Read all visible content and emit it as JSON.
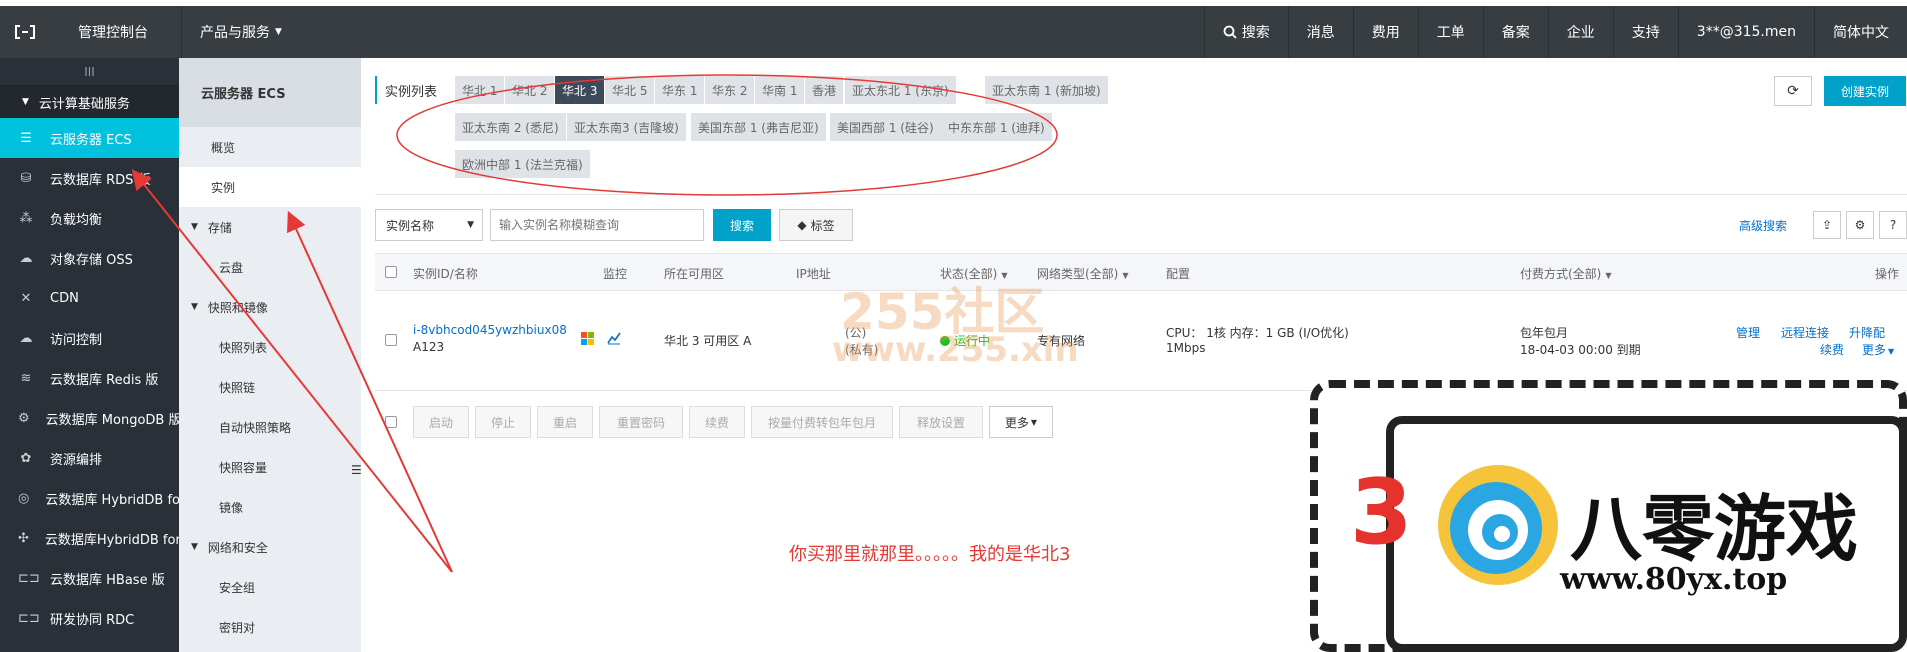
{
  "topbar": {
    "console": "管理控制台",
    "products": "产品与服务",
    "search": "搜索",
    "messages": "消息",
    "billing": "费用",
    "tickets": "工单",
    "icp": "备案",
    "enterprise": "企业",
    "support": "支持",
    "account": "3**@315.men",
    "language": "简体中文"
  },
  "sidebar": {
    "collapse": "III",
    "group": "云计算基础服务",
    "items": [
      {
        "label": "云服务器 ECS",
        "icon": "server-icon"
      },
      {
        "label": "云数据库 RDS 版",
        "icon": "database-icon"
      },
      {
        "label": "负载均衡",
        "icon": "balance-icon"
      },
      {
        "label": "对象存储 OSS",
        "icon": "storage-icon"
      },
      {
        "label": "CDN",
        "icon": "cdn-icon"
      },
      {
        "label": "访问控制",
        "icon": "access-icon"
      },
      {
        "label": "云数据库 Redis 版",
        "icon": "redis-icon"
      },
      {
        "label": "云数据库 MongoDB 版",
        "icon": "mongodb-icon"
      },
      {
        "label": "资源编排",
        "icon": "orchestration-icon"
      },
      {
        "label": "云数据库 HybridDB fo...",
        "icon": "hybriddb-icon"
      },
      {
        "label": "云数据库HybridDB for...",
        "icon": "hybriddb2-icon"
      },
      {
        "label": "云数据库 HBase 版",
        "icon": "hbase-icon"
      },
      {
        "label": "研发协同 RDC",
        "icon": "rdc-icon"
      }
    ]
  },
  "sub": {
    "head": "云服务器 ECS",
    "overview": "概览",
    "instances": "实例",
    "storage": "存储",
    "disk": "云盘",
    "snapshots": "快照和镜像",
    "snapshot_list": "快照列表",
    "snapshot_chain": "快照链",
    "auto_policy": "自动快照策略",
    "snapshot_capacity": "快照容量",
    "image": "镜像",
    "network": "网络和安全",
    "security_group": "安全组",
    "keypair": "密钥对"
  },
  "regions": {
    "label": "实例列表",
    "items": [
      "华北 1",
      "华北 2",
      "华北 3",
      "华北 5",
      "华东 1",
      "华东 2",
      "华南 1",
      "香港",
      "亚太东北 1 (东京)",
      "亚太东南 1 (新加坡)",
      "亚太东南 2 (悉尼)",
      "亚太东南3 (吉隆坡)",
      "美国东部 1 (弗吉尼亚)",
      "美国西部 1 (硅谷)",
      "中东东部 1 (迪拜)",
      "欧洲中部 1 (法兰克福)"
    ]
  },
  "actions": {
    "create": "创建实例"
  },
  "search": {
    "select": "实例名称",
    "placeholder": "输入实例名称模糊查询",
    "button": "搜索",
    "tag": "标签",
    "advanced": "高级搜索"
  },
  "table": {
    "headers": {
      "id": "实例ID/名称",
      "monitor": "监控",
      "zone": "所在可用区",
      "ip": "IP地址",
      "status": "状态(全部)",
      "network": "网络类型(全部)",
      "config": "配置",
      "billing": "付费方式(全部)",
      "ops": "操作"
    },
    "row": {
      "id": "i-8vbhcod045ywzhbiux08",
      "name": "A123",
      "zone": "华北 3 可用区 A",
      "ip_public": "(公)",
      "ip_private": "(私有)",
      "status": "运行中",
      "network": "专有网络",
      "config_line1": "CPU： 1核    内存：1 GB (I/O优化)",
      "config_line2": "1Mbps",
      "billing_line1": "包年包月",
      "billing_line2": "18-04-03 00:00 到期",
      "op_manage": "管理",
      "op_remote": "远程连接",
      "op_upgrade": "升降配",
      "op_renew": "续费",
      "op_more": "更多"
    }
  },
  "bulk": [
    "启动",
    "停止",
    "重启",
    "重置密码",
    "续费",
    "按量付费转包年包月",
    "释放设置",
    "更多"
  ],
  "note": "你买那里就那里。。。。。我的是华北3",
  "watermark": {
    "line1": "255社区",
    "line2": "www.255.xin"
  },
  "logo80": {
    "title": "八零游戏",
    "url": "www.80yx.top",
    "digit": "3"
  }
}
